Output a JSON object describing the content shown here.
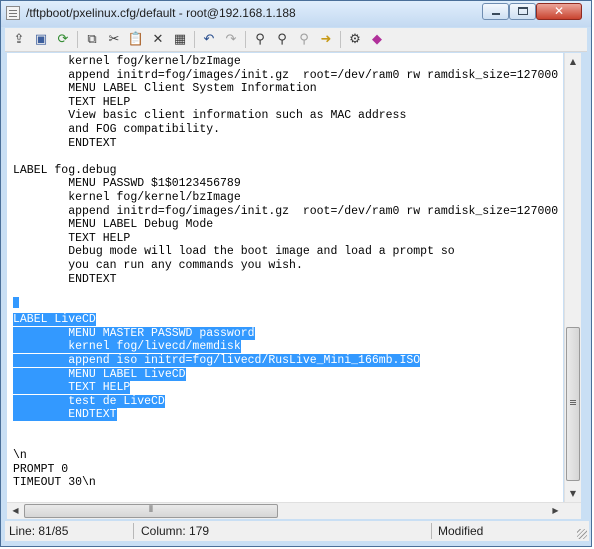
{
  "window": {
    "title": "/tftpboot/pxelinux.cfg/default - root@192.168.1.188"
  },
  "toolbar": {
    "buttons": [
      {
        "icon": "upload-icon"
      },
      {
        "icon": "save-icon"
      },
      {
        "icon": "refresh-icon"
      },
      {
        "icon": "copy-icon"
      },
      {
        "icon": "cut-icon"
      },
      {
        "icon": "paste-icon"
      },
      {
        "icon": "delete-icon"
      },
      {
        "icon": "select-all-icon"
      },
      {
        "icon": "undo-icon"
      },
      {
        "icon": "redo-icon"
      },
      {
        "icon": "find-icon"
      },
      {
        "icon": "find-next-icon"
      },
      {
        "icon": "replace-icon"
      },
      {
        "icon": "goto-icon"
      },
      {
        "icon": "settings-icon"
      },
      {
        "icon": "help-icon"
      }
    ]
  },
  "editor": {
    "lines": [
      {
        "text": "        kernel fog/kernel/bzImage",
        "selected": false
      },
      {
        "text": "        append initrd=fog/images/init.gz  root=/dev/ram0 rw ramdisk_size=127000",
        "selected": false
      },
      {
        "text": "        MENU LABEL Client System Information",
        "selected": false
      },
      {
        "text": "        TEXT HELP",
        "selected": false
      },
      {
        "text": "        View basic client information such as MAC address",
        "selected": false
      },
      {
        "text": "        and FOG compatibility.",
        "selected": false
      },
      {
        "text": "        ENDTEXT",
        "selected": false
      },
      {
        "text": "",
        "selected": false
      },
      {
        "text": "LABEL fog.debug",
        "selected": false
      },
      {
        "text": "        MENU PASSWD $1$0123456789",
        "selected": false
      },
      {
        "text": "        kernel fog/kernel/bzImage",
        "selected": false
      },
      {
        "text": "        append initrd=fog/images/init.gz  root=/dev/ram0 rw ramdisk_size=127000",
        "selected": false
      },
      {
        "text": "        MENU LABEL Debug Mode",
        "selected": false
      },
      {
        "text": "        TEXT HELP",
        "selected": false
      },
      {
        "text": "        Debug mode will load the boot image and load a prompt so",
        "selected": false
      },
      {
        "text": "        you can run any commands you wish.",
        "selected": false
      },
      {
        "text": "        ENDTEXT",
        "selected": false
      },
      {
        "text": "",
        "selected": false
      },
      {
        "text": "",
        "selected": false
      },
      {
        "text": "LABEL LiveCD",
        "selected": true
      },
      {
        "text": "        MENU MASTER PASSWD password",
        "selected": true
      },
      {
        "text": "        kernel fog/livecd/memdisk",
        "selected": true
      },
      {
        "text": "        append iso initrd=fog/livecd/RusLive_Mini_166mb.ISO",
        "selected": true
      },
      {
        "text": "        MENU LABEL LiveCD",
        "selected": true
      },
      {
        "text": "        TEXT HELP",
        "selected": true
      },
      {
        "text": "        test de LiveCD",
        "selected": true
      },
      {
        "text": "        ENDTEXT",
        "selected": true
      },
      {
        "text": "",
        "selected": false
      },
      {
        "text": "",
        "selected": false
      },
      {
        "text": "\\n",
        "selected": false
      },
      {
        "text": "PROMPT 0",
        "selected": false
      },
      {
        "text": "TIMEOUT 30\\n",
        "selected": false
      }
    ]
  },
  "status": {
    "line": "Line: 81/85",
    "column": "Column: 179",
    "state": "Modified"
  }
}
